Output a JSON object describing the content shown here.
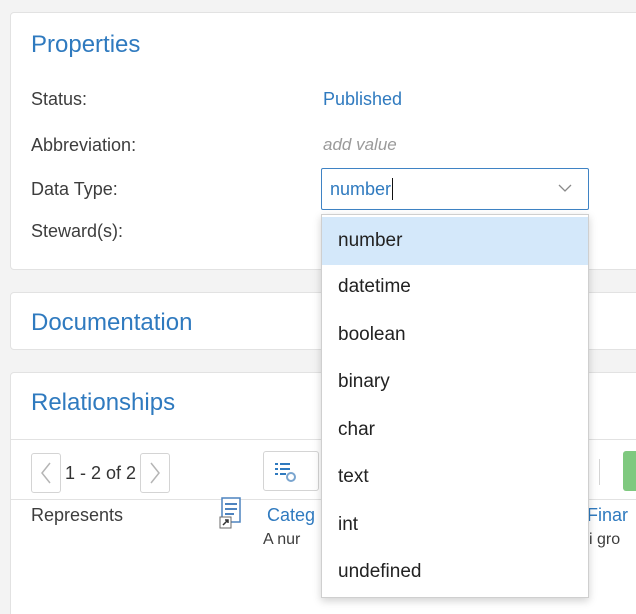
{
  "properties": {
    "title": "Properties",
    "rows": [
      {
        "label": "Status:",
        "value": "Published"
      },
      {
        "label": "Abbreviation:",
        "value": "add value"
      },
      {
        "label": "Data Type:",
        "value": "number"
      },
      {
        "label": "Steward(s):",
        "value": ""
      }
    ]
  },
  "datatype_select": {
    "value": "number",
    "options": [
      "number",
      "datetime",
      "boolean",
      "binary",
      "char",
      "text",
      "int",
      "undefined"
    ],
    "selected": "number"
  },
  "documentation": {
    "title": "Documentation"
  },
  "relationships": {
    "title": "Relationships",
    "pager_text": "1 - 2 of 2",
    "rows": [
      {
        "type": "Represents",
        "left_link": "Categ",
        "left_desc": "A nur",
        "right_link": "Finar",
        "right_desc": "i gro"
      }
    ]
  },
  "colors": {
    "accent": "#2f7abf",
    "selected_bg": "#d4e8fa",
    "green_button": "#7fc97f"
  },
  "icons": {
    "chevron": "chevron-down-icon",
    "pager_prev": "chevron-left-icon",
    "pager_next": "chevron-right-icon",
    "view_settings": "list-settings-icon",
    "document": "document-shortcut-icon"
  }
}
